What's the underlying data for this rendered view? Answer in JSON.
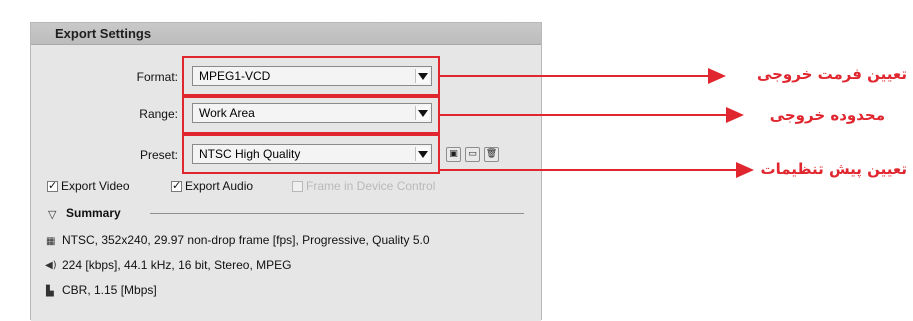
{
  "panel": {
    "title": "Export Settings"
  },
  "fields": {
    "format": {
      "label": "Format:",
      "value": "MPEG1-VCD"
    },
    "range": {
      "label": "Range:",
      "value": "Work Area"
    },
    "preset": {
      "label": "Preset:",
      "value": "NTSC High Quality"
    }
  },
  "preset_buttons": {
    "save_glyph": "▣",
    "import_glyph": "▭",
    "delete_glyph": "🗑"
  },
  "checkboxes": {
    "export_video": {
      "label": "Export Video",
      "checked": true
    },
    "export_audio": {
      "label": "Export Audio",
      "checked": true
    },
    "device_control": {
      "label": "Frame in Device Control",
      "checked": false,
      "disabled": true
    }
  },
  "summary": {
    "title": "Summary",
    "toggle_glyph": "▽",
    "lines": [
      {
        "icon_name": "film-icon",
        "glyph": "▦",
        "text": "NTSC, 352x240, 29.97 non-drop frame [fps], Progressive, Quality 5.0"
      },
      {
        "icon_name": "speaker-icon",
        "glyph": "◀)",
        "text": "224 [kbps], 44.1 kHz, 16 bit, Stereo, MPEG"
      },
      {
        "icon_name": "bitrate-icon",
        "glyph": "▙",
        "text": "CBR, 1.15 [Mbps]"
      }
    ]
  },
  "annotations": [
    {
      "text": "تعیین فرمت خروجی"
    },
    {
      "text": "محدوده خروجی"
    },
    {
      "text": "تعیین پیش تنظیمات"
    }
  ],
  "colors": {
    "highlight": "#e0262f",
    "annotation": "#e0262f"
  }
}
